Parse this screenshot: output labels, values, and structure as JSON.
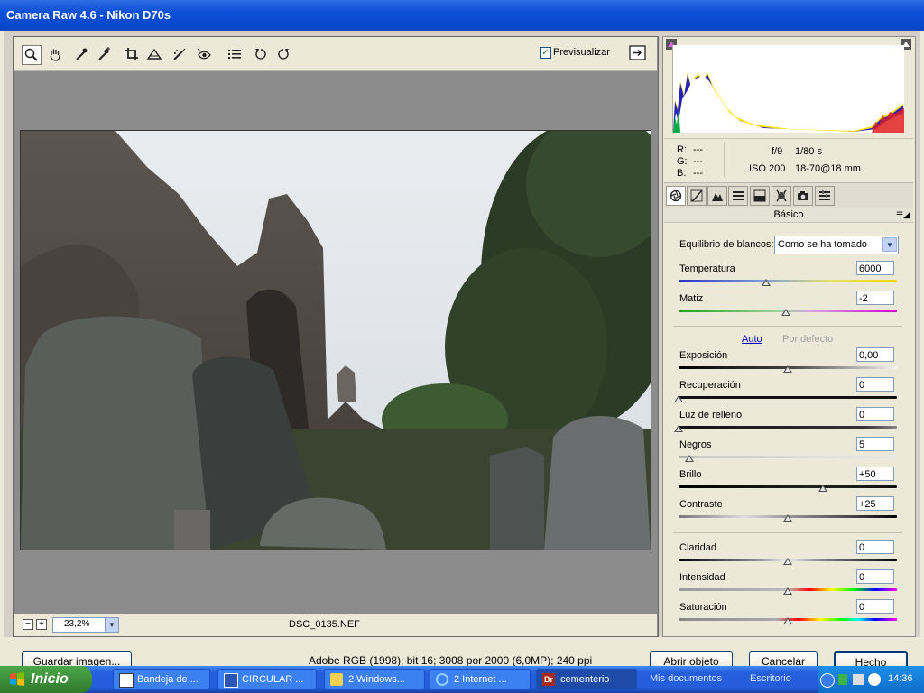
{
  "window": {
    "title": "Camera Raw 4.6 -  Nikon D70s"
  },
  "toolbar": {
    "tools": [
      "zoom-tool-icon",
      "hand-tool-icon",
      "white-balance-tool-icon",
      "color-sampler-tool-icon",
      "crop-tool-icon",
      "straighten-tool-icon",
      "retouch-tool-icon",
      "red-eye-tool-icon",
      "preferences-icon",
      "rotate-left-icon",
      "rotate-right-icon"
    ],
    "preview_label": "Previsualizar",
    "preview_checked": true
  },
  "image": {
    "filename": "DSC_0135.NEF"
  },
  "zoom": {
    "value": "23,2%"
  },
  "readout": {
    "r_label": "R:",
    "r_value": "---",
    "g_label": "G:",
    "g_value": "---",
    "b_label": "B:",
    "b_value": "---",
    "aperture": "f/9",
    "shutter": "1/80 s",
    "iso": "ISO 200",
    "lens": "18-70@18 mm"
  },
  "panel": {
    "tabs": [
      "basic-tab-icon",
      "tone-curve-tab-icon",
      "detail-tab-icon",
      "hsl-tab-icon",
      "split-toning-tab-icon",
      "lens-corrections-tab-icon",
      "camera-calibration-tab-icon",
      "presets-tab-icon"
    ],
    "title": "Básico",
    "wb_label": "Equilibrio de blancos:",
    "wb_value": "Como se ha tomado",
    "auto_label": "Auto",
    "default_label": "Por defecto",
    "sliders": {
      "temperature": {
        "label": "Temperatura",
        "value": "6000",
        "level": 0.4
      },
      "tint": {
        "label": "Matiz",
        "value": "-2",
        "level": 0.49
      },
      "exposure": {
        "label": "Exposición",
        "value": "0,00",
        "level": 0.5
      },
      "recovery": {
        "label": "Recuperación",
        "value": "0",
        "level": 0.0
      },
      "fill_light": {
        "label": "Luz de relleno",
        "value": "0",
        "level": 0.0
      },
      "blacks": {
        "label": "Negros",
        "value": "5",
        "level": 0.05
      },
      "brightness": {
        "label": "Brillo",
        "value": "+50",
        "level": 0.66
      },
      "contrast": {
        "label": "Contraste",
        "value": "+25",
        "level": 0.5
      },
      "clarity": {
        "label": "Claridad",
        "value": "0",
        "level": 0.5
      },
      "vibrance": {
        "label": "Intensidad",
        "value": "0",
        "level": 0.5
      },
      "saturation": {
        "label": "Saturación",
        "value": "0",
        "level": 0.5
      }
    }
  },
  "footer": {
    "save_label": "Guardar imagen...",
    "color_info": "Adobe RGB (1998); bit 16; 3008 por 2000 (6,0MP); 240 ppi",
    "open_label": "Abrir objeto",
    "cancel_label": "Cancelar",
    "done_label": "Hecho"
  },
  "taskbar": {
    "start_label": "Inicio",
    "items": [
      "Bandeja de ...",
      "CIRCULAR ...",
      "2 Windows...",
      "2 Internet ...",
      "cementerio"
    ],
    "links": [
      "Mis documentos",
      "Escritorio"
    ],
    "clock": "14:36"
  }
}
